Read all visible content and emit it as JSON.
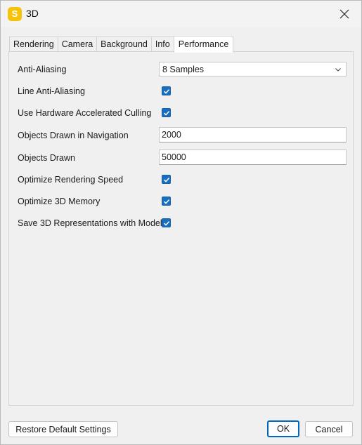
{
  "window": {
    "title": "3D",
    "app_icon_letter": "S"
  },
  "tabs": [
    {
      "label": "Rendering"
    },
    {
      "label": "Camera"
    },
    {
      "label": "Background"
    },
    {
      "label": "Info"
    },
    {
      "label": "Performance",
      "active": true
    }
  ],
  "settings": {
    "anti_aliasing": {
      "label": "Anti-Aliasing",
      "value": "8 Samples"
    },
    "line_anti_aliasing": {
      "label": "Line Anti-Aliasing",
      "checked": true
    },
    "hw_culling": {
      "label": "Use Hardware Accelerated Culling",
      "checked": true
    },
    "objects_nav": {
      "label": "Objects Drawn in Navigation",
      "value": "2000"
    },
    "objects_drawn": {
      "label": "Objects Drawn",
      "value": "50000"
    },
    "optimize_speed": {
      "label": "Optimize Rendering Speed",
      "checked": true
    },
    "optimize_memory": {
      "label": "Optimize 3D Memory",
      "checked": true
    },
    "save_repr": {
      "label": "Save 3D Representations with Model",
      "checked": true
    }
  },
  "buttons": {
    "restore": "Restore Default Settings",
    "ok": "OK",
    "cancel": "Cancel"
  },
  "colors": {
    "accent": "#1a6ec0",
    "app_icon": "#f7c20a"
  }
}
